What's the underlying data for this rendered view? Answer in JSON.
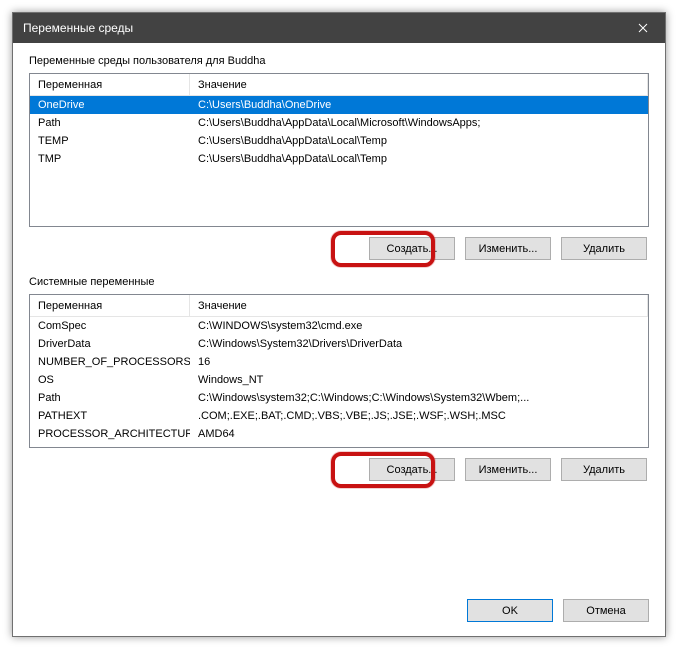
{
  "window": {
    "title": "Переменные среды"
  },
  "userSection": {
    "label": "Переменные среды пользователя для Buddha",
    "headers": {
      "name": "Переменная",
      "value": "Значение"
    },
    "rows": [
      {
        "name": "OneDrive",
        "value": "C:\\Users\\Buddha\\OneDrive",
        "selected": true
      },
      {
        "name": "Path",
        "value": "C:\\Users\\Buddha\\AppData\\Local\\Microsoft\\WindowsApps;",
        "selected": false
      },
      {
        "name": "TEMP",
        "value": "C:\\Users\\Buddha\\AppData\\Local\\Temp",
        "selected": false
      },
      {
        "name": "TMP",
        "value": "C:\\Users\\Buddha\\AppData\\Local\\Temp",
        "selected": false
      }
    ],
    "buttons": {
      "create": "Создать...",
      "edit": "Изменить...",
      "delete": "Удалить"
    }
  },
  "systemSection": {
    "label": "Системные переменные",
    "headers": {
      "name": "Переменная",
      "value": "Значение"
    },
    "rows": [
      {
        "name": "ComSpec",
        "value": "C:\\WINDOWS\\system32\\cmd.exe"
      },
      {
        "name": "DriverData",
        "value": "C:\\Windows\\System32\\Drivers\\DriverData"
      },
      {
        "name": "NUMBER_OF_PROCESSORS",
        "value": "16"
      },
      {
        "name": "OS",
        "value": "Windows_NT"
      },
      {
        "name": "Path",
        "value": "C:\\Windows\\system32;C:\\Windows;C:\\Windows\\System32\\Wbem;..."
      },
      {
        "name": "PATHEXT",
        "value": ".COM;.EXE;.BAT;.CMD;.VBS;.VBE;.JS;.JSE;.WSF;.WSH;.MSC"
      },
      {
        "name": "PROCESSOR_ARCHITECTURE",
        "value": "AMD64"
      }
    ],
    "buttons": {
      "create": "Создать...",
      "edit": "Изменить...",
      "delete": "Удалить"
    }
  },
  "footer": {
    "ok": "OK",
    "cancel": "Отмена"
  }
}
